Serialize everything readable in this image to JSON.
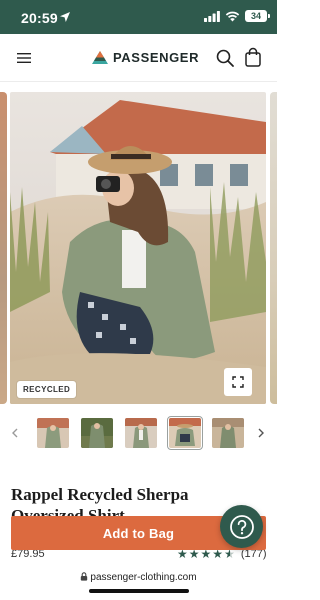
{
  "status_bar": {
    "time": "20:59",
    "battery": "34"
  },
  "header": {
    "brand": "PASSENGER",
    "icons": {
      "menu": "hamburger-icon",
      "search": "search-icon",
      "bag": "bag-icon"
    }
  },
  "gallery": {
    "badge": "RECYCLED",
    "expand_icon": "expand-icon",
    "thumbnails_count_note": "5",
    "active_thumbnail": 4
  },
  "product": {
    "title": "Rappel Recycled Sherpa Oversized Shirt",
    "price": "£79.95",
    "rating": 4.5,
    "review_count": "(177)"
  },
  "cta": {
    "add_to_bag": "Add to Bag",
    "help_icon": "question-icon"
  },
  "browser": {
    "url": "passenger-clothing.com"
  },
  "colors": {
    "brand_green": "#2f5a4d",
    "cta_orange": "#dc6a3f"
  }
}
